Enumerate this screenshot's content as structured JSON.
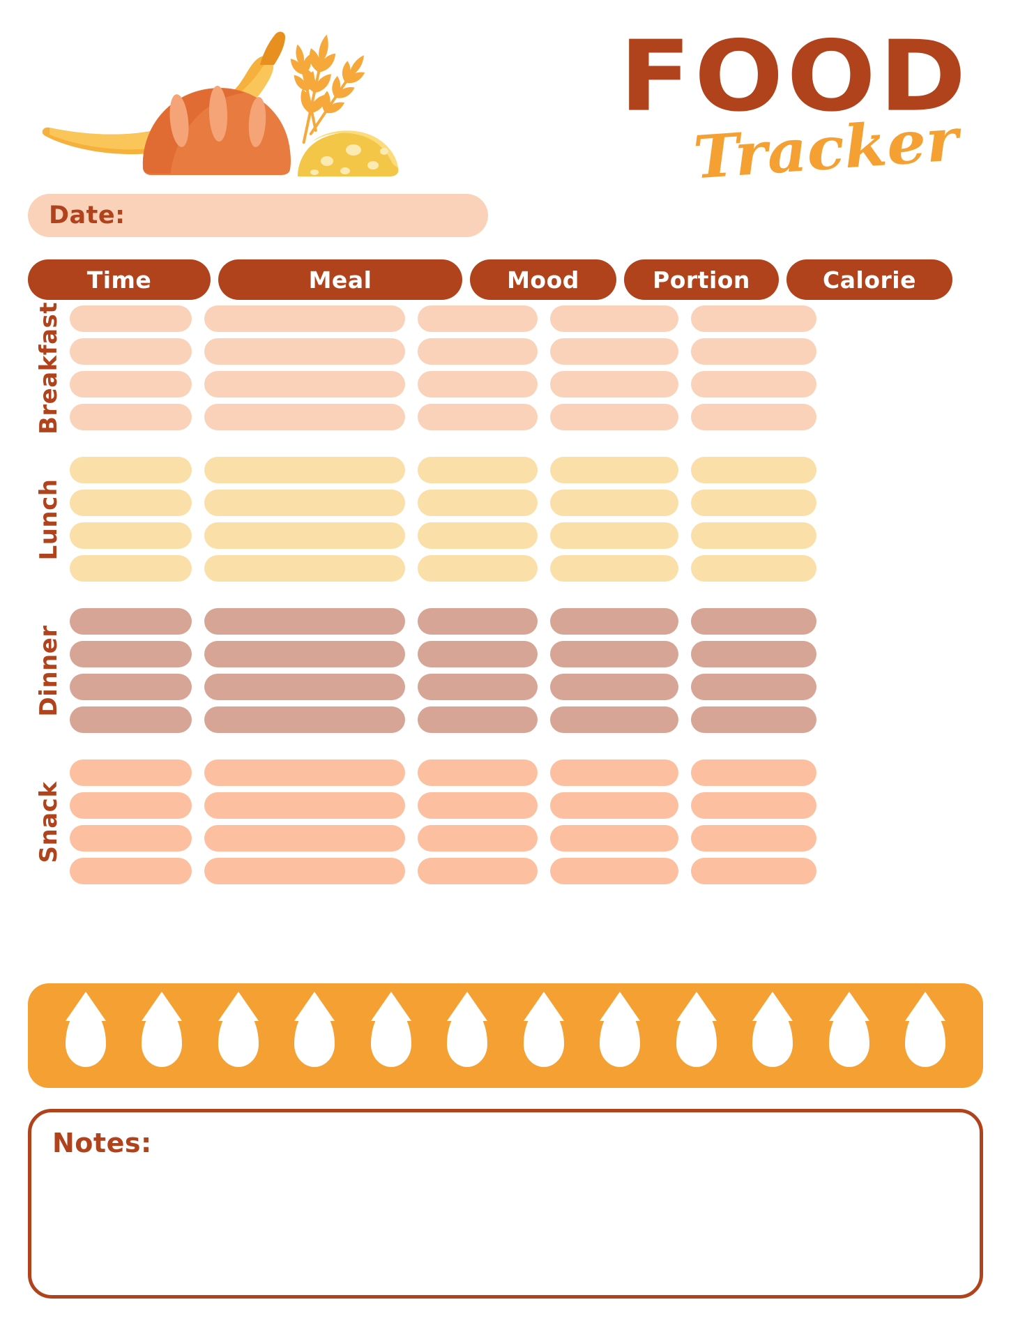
{
  "document": {
    "title_line1": "FOOD",
    "title_line2": "Tracker"
  },
  "illustration": {
    "name": "food-illustration",
    "items": [
      "banana",
      "bread-loaf",
      "wheat-stalks",
      "cheese-wedge"
    ]
  },
  "date_field": {
    "label": "Date:",
    "value": ""
  },
  "table": {
    "columns": [
      {
        "key": "time",
        "label": "Time"
      },
      {
        "key": "meal",
        "label": "Meal"
      },
      {
        "key": "mood",
        "label": "Mood"
      },
      {
        "key": "portion",
        "label": "Portion"
      },
      {
        "key": "calorie",
        "label": "Calorie"
      }
    ],
    "groups": [
      {
        "key": "breakfast",
        "label": "Breakfast",
        "row_count": 4,
        "fill": "#FAD2BA"
      },
      {
        "key": "lunch",
        "label": "Lunch",
        "row_count": 4,
        "fill": "#FBDFA8"
      },
      {
        "key": "dinner",
        "label": "Dinner",
        "row_count": 4,
        "fill": "#D6A595"
      },
      {
        "key": "snack",
        "label": "Snack",
        "row_count": 4,
        "fill": "#FCC0A0"
      }
    ]
  },
  "water_tracker": {
    "droplet_count": 12,
    "bar_color": "#F5A033",
    "droplet_color": "#FFFFFF"
  },
  "notes": {
    "label": "Notes:",
    "value": ""
  },
  "colors": {
    "brand_brown": "#B0431C",
    "accent_orange": "#F5A033",
    "breakfast_peach": "#FAD2BA",
    "lunch_cream": "#FBDFA8",
    "dinner_rose": "#D6A595",
    "snack_salmon": "#FCC0A0",
    "page_background": "#FFFFFF"
  }
}
